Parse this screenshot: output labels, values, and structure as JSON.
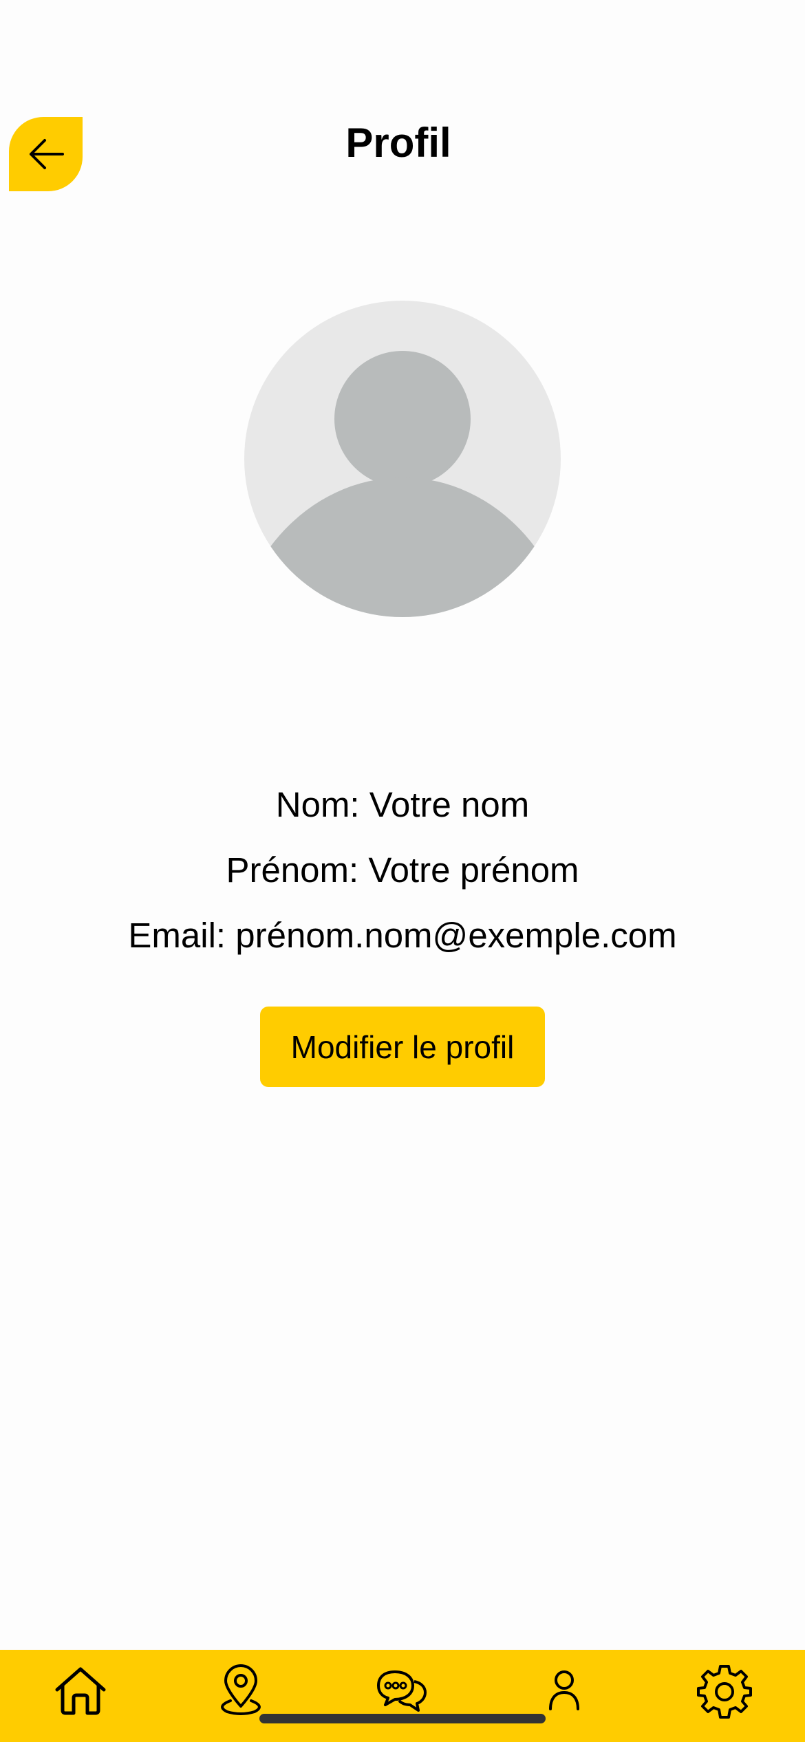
{
  "header": {
    "title": "Profil",
    "back_icon": "arrow-left-icon"
  },
  "avatar": {
    "icon": "default-user-avatar",
    "background_color": "#E8E8E8",
    "figure_color": "#B8BBBB"
  },
  "profile": {
    "nom_line": "Nom: Votre nom",
    "prenom_line": "Prénom: Votre prénom",
    "email_line": "Email: prénom.nom@exemple.com"
  },
  "actions": {
    "edit_label": "Modifier le profil"
  },
  "tab_bar": {
    "items": [
      {
        "icon": "home-icon"
      },
      {
        "icon": "map-pin-icon"
      },
      {
        "icon": "chat-bubbles-icon"
      },
      {
        "icon": "user-icon"
      },
      {
        "icon": "gear-icon"
      }
    ]
  },
  "colors": {
    "accent": "#FFCC00",
    "background": "#FDFDFD",
    "text": "#000000"
  }
}
